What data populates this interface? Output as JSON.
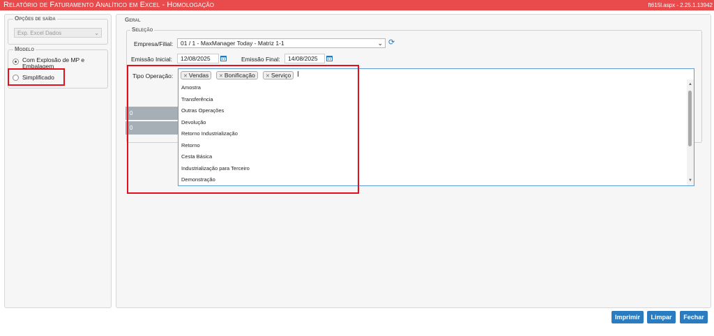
{
  "header": {
    "title": "Relatório de Faturamento Analítico em Excel - Homologação",
    "version": "ft615l.aspx - 2.25.1.13942"
  },
  "sidebar": {
    "output_options_title": "Opções de saída",
    "output_select_value": "Exp. Excel Dados",
    "model_title": "Modelo",
    "model_options": [
      {
        "label": "Com Explosão de MP e Embalagem",
        "checked": true
      },
      {
        "label": "Simplificado",
        "checked": false
      }
    ]
  },
  "main": {
    "general_title": "Geral",
    "selection_title": "Seleção",
    "empresa_label": "Empresa/Filial:",
    "empresa_value": "01 / 1 - MaxManager Today - Matriz 1-1",
    "emissao_inicial_label": "Emissão Inicial:",
    "emissao_inicial_value": "12/08/2025",
    "emissao_final_label": "Emissão Final:",
    "emissao_final_value": "14/08/2025",
    "tipo_operacao_label": "Tipo Operação:",
    "selected_tags": [
      "Vendas",
      "Bonificação",
      "Serviço"
    ],
    "dropdown_options": [
      "Amostra",
      "Transferência",
      "Outras Operações",
      "Devolução",
      "Retorno Industrialização",
      "Retorno",
      "Cesta Básica",
      "Industrialização para Terceiro",
      "Demonstração"
    ],
    "gray_rows": [
      "0",
      "0"
    ]
  },
  "buttons": {
    "print": "Imprimir",
    "clear": "Limpar",
    "close": "Fechar"
  },
  "colors": {
    "header_bg": "#e94a4b",
    "button_bg": "#2a7bbf",
    "highlight": "#e1101b"
  }
}
